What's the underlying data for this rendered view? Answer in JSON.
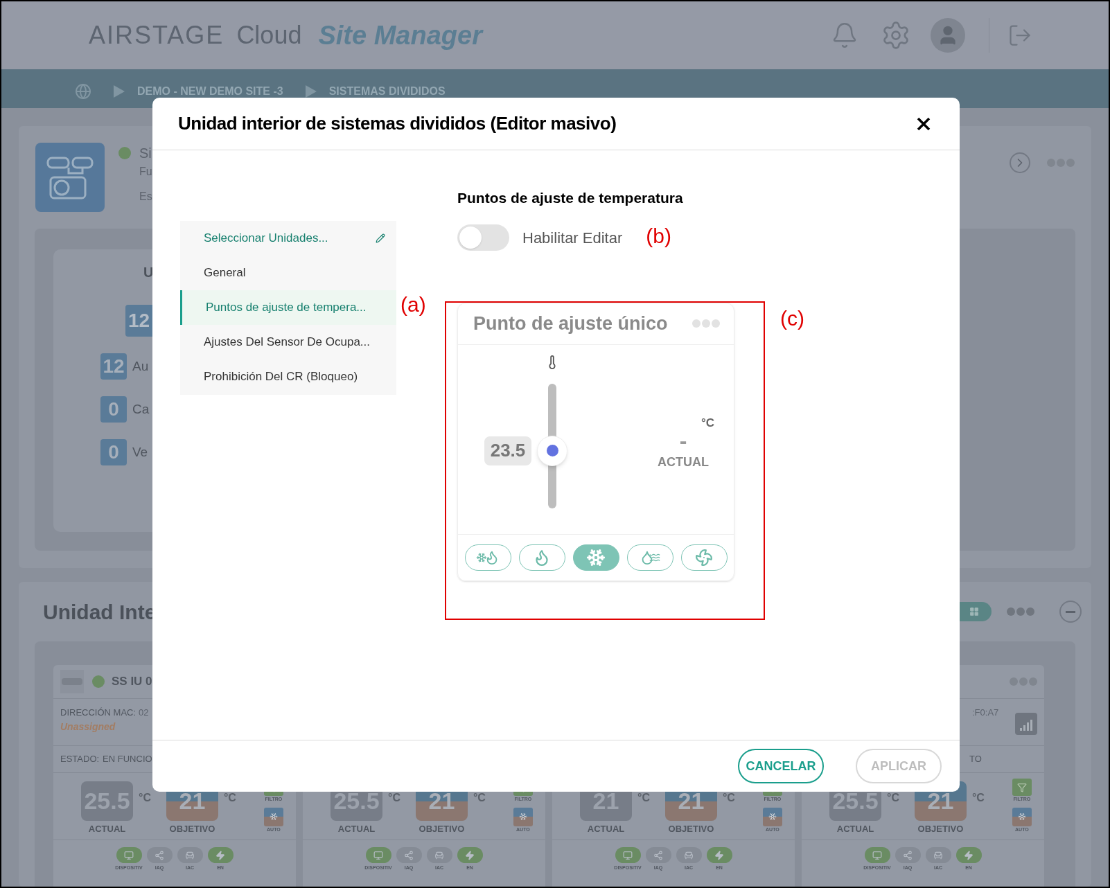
{
  "header": {
    "brand": "AIRSTAGE",
    "cloud": "Cloud",
    "product": "Site Manager"
  },
  "breadcrumb": [
    "DEMO - NEW DEMO SITE -3",
    "SISTEMAS DIVIDIDOS"
  ],
  "site_card": {
    "name": "Si",
    "line_2": "Fu",
    "line_3": "Es",
    "summary": {
      "title": "U",
      "total": "12",
      "rows": [
        {
          "count": "12",
          "label": "Au"
        },
        {
          "count": "0",
          "label": "Ca"
        },
        {
          "count": "0",
          "label": "Ve"
        }
      ]
    }
  },
  "units_panel": {
    "title": "Unidad Inte",
    "cards": [
      {
        "name": "SS IU 0",
        "mac_label": "DIRECCIÓN MAC:",
        "mac": "02",
        "assignment": "Unassigned",
        "status_label": "ESTADO:",
        "status": "EN FUNCIO",
        "actual": "25.5",
        "actual_unit": "°C",
        "actual_label": "ACTUAL",
        "target": "21",
        "target_unit": "°C",
        "target_label": "OBJETIVO",
        "filter_label": "FILTRO",
        "mode_label": "AUTO",
        "features": [
          {
            "kind": "device",
            "label": "DISPOSITIV",
            "on": true
          },
          {
            "kind": "iaq",
            "label": "IAQ",
            "on": false
          },
          {
            "kind": "iac",
            "label": "IAC",
            "on": false
          },
          {
            "kind": "energy",
            "label": "EN",
            "on": true
          }
        ]
      },
      {
        "actual": "25.5",
        "actual_unit": "°C",
        "actual_label": "ACTUAL",
        "target": "21",
        "target_unit": "°C",
        "target_label": "OBJETIVO",
        "filter_label": "FILTRO",
        "mode_label": "AUTO",
        "features": [
          {
            "kind": "device",
            "label": "DISPOSITIV",
            "on": true
          },
          {
            "kind": "iaq",
            "label": "IAQ",
            "on": false
          },
          {
            "kind": "iac",
            "label": "IAC",
            "on": false
          },
          {
            "kind": "energy",
            "label": "EN",
            "on": true
          }
        ]
      },
      {
        "actual": "21",
        "actual_unit": "°C",
        "actual_label": "ACTUAL",
        "target": "21",
        "target_unit": "°C",
        "target_label": "OBJETIVO",
        "filter_label": "FILTRO",
        "mode_label": "AUTO",
        "features": [
          {
            "kind": "device",
            "label": "DISPOSITIV",
            "on": true
          },
          {
            "kind": "iaq",
            "label": "IAQ",
            "on": false
          },
          {
            "kind": "iac",
            "label": "IAC",
            "on": false
          },
          {
            "kind": "energy",
            "label": "EN",
            "on": true
          }
        ]
      },
      {
        "mac": ":F0:A7",
        "status": "TO",
        "actual": "25.5",
        "actual_unit": "°C",
        "actual_label": "ACTUAL",
        "target": "21",
        "target_unit": "°C",
        "target_label": "OBJETIVO",
        "filter_label": "FILTRO",
        "mode_label": "AUTO",
        "features": [
          {
            "kind": "device",
            "label": "DISPOSITIV",
            "on": true
          },
          {
            "kind": "iaq",
            "label": "IAQ",
            "on": false
          },
          {
            "kind": "iac",
            "label": "IAC",
            "on": false
          },
          {
            "kind": "energy",
            "label": "EN",
            "on": true
          }
        ]
      }
    ]
  },
  "modal": {
    "title": "Unidad interior de sistemas divididos (Editor masivo)",
    "nav": [
      {
        "kind": "picker",
        "label": "Seleccionar Unidades...",
        "selected": false
      },
      {
        "kind": "section",
        "label": "General",
        "selected": false
      },
      {
        "kind": "section",
        "label": "Puntos de ajuste de tempera...",
        "selected": true
      },
      {
        "kind": "section",
        "label": "Ajustes Del Sensor De Ocupa...",
        "selected": false
      },
      {
        "kind": "section",
        "label": "Prohibición Del CR (Bloqueo)",
        "selected": false
      }
    ],
    "heading": "Puntos de ajuste de temperatura",
    "enable_edit": {
      "label": "Habilitar Editar",
      "on": false
    },
    "setpoint_card": {
      "title": "Punto de ajuste único",
      "value": "23.5",
      "level": 0.46,
      "unit": "°C",
      "actual": "-",
      "actual_label": "ACTUAL",
      "modes": [
        {
          "kind": "auto",
          "selected": false
        },
        {
          "kind": "heat",
          "selected": false
        },
        {
          "kind": "cool",
          "selected": true
        },
        {
          "kind": "dry",
          "selected": false
        },
        {
          "kind": "fan",
          "selected": false
        }
      ]
    },
    "buttons": [
      {
        "label": "CANCELAR",
        "disabled": false
      },
      {
        "label": "APLICAR",
        "disabled": true
      }
    ],
    "annotations": [
      "(a)",
      "(b)",
      "(c)"
    ]
  }
}
